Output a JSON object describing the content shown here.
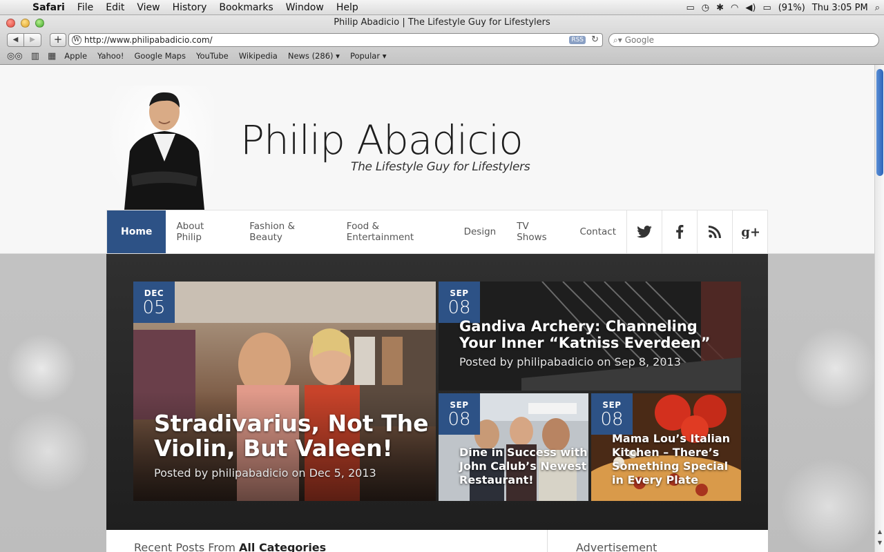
{
  "menubar": {
    "apple_icon": "apple-icon",
    "items": [
      "Safari",
      "File",
      "Edit",
      "View",
      "History",
      "Bookmarks",
      "Window",
      "Help"
    ],
    "battery": "(91%)",
    "clock": "Thu 3:05 PM"
  },
  "window": {
    "title": "Philip Abadicio | The Lifestyle Guy for Lifestylers",
    "url": "http://www.philipabadicio.com/",
    "rss_label": "RSS",
    "search_placeholder": "Google"
  },
  "bookmarks": {
    "items": [
      "Apple",
      "Yahoo!",
      "Google Maps",
      "YouTube",
      "Wikipedia",
      "News (286) ▾",
      "Popular ▾"
    ]
  },
  "site": {
    "title": "Philip Abadicio",
    "tagline": "The Lifestyle Guy for Lifestylers",
    "nav": {
      "home": "Home",
      "items": [
        "About Philip",
        "Fashion & Beauty",
        "Food & Entertainment",
        "Design",
        "TV Shows",
        "Contact"
      ]
    },
    "social": [
      "twitter-icon",
      "facebook-icon",
      "rss-icon",
      "google-plus-icon"
    ],
    "accent_color": "#2d5286"
  },
  "featured": [
    {
      "month": "DEC",
      "day": "05",
      "title": "Stradivarius, Not The Violin, But Valeen!",
      "meta": "Posted by philipabadicio on Dec 5, 2013"
    },
    {
      "month": "SEP",
      "day": "08",
      "title": "Gandiva Archery: Channeling Your Inner “Katniss Everdeen”",
      "meta": "Posted by philipabadicio on Sep 8, 2013"
    },
    {
      "month": "SEP",
      "day": "08",
      "title": "Dine in Success with John Calub’s Newest Restaurant!",
      "meta": ""
    },
    {
      "month": "SEP",
      "day": "08",
      "title": "Mama Lou’s Italian Kitchen – There’s Something Special in Every Plate",
      "meta": ""
    }
  ],
  "below": {
    "recent_prefix": "Recent Posts From ",
    "recent_bold": "All Categories",
    "advertisement": "Advertisement"
  }
}
